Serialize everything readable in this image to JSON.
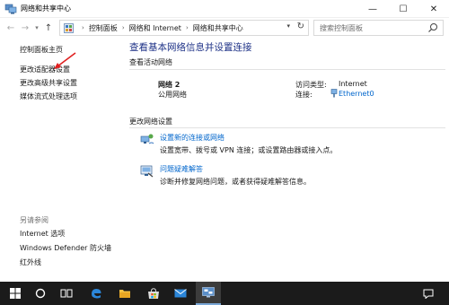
{
  "window": {
    "title": "网络和共享中心",
    "minimize": "—",
    "maximize": "☐",
    "close": "✕"
  },
  "address_bar": {
    "breadcrumbs": [
      "控制面板",
      "网络和 Internet",
      "网络和共享中心"
    ],
    "separator": "›",
    "search_placeholder": "搜索控制面板"
  },
  "sidebar": {
    "items": [
      {
        "label": "控制面板主页"
      },
      {
        "label": "更改适配器设置"
      },
      {
        "label": "更改高级共享设置"
      },
      {
        "label": "媒体流式处理选项"
      }
    ],
    "see_also_title": "另请参阅",
    "see_also": [
      {
        "label": "Internet 选项"
      },
      {
        "label": "Windows Defender 防火墙"
      },
      {
        "label": "红外线"
      }
    ]
  },
  "main": {
    "title": "查看基本网络信息并设置连接",
    "active_networks_label": "查看活动网络",
    "network": {
      "name": "网络 2",
      "type": "公用网络",
      "access_type_label": "访问类型:",
      "access_type_value": "Internet",
      "connections_label": "连接:",
      "connections_value": "Ethernet0"
    },
    "change_settings_label": "更改网络设置",
    "tasks": [
      {
        "link": "设置新的连接或网络",
        "desc": "设置宽带、拨号或 VPN 连接；或设置路由器或接入点。"
      },
      {
        "link": "问题疑难解答",
        "desc": "诊断并修复网络问题，或者获得疑难解答信息。"
      }
    ]
  },
  "taskbar": {
    "items": [
      "start-icon",
      "cortana-icon",
      "task-view-icon",
      "edge-icon",
      "file-explorer-icon",
      "store-icon",
      "mail-icon",
      "control-panel-icon"
    ],
    "show_desktop": "notification-icon"
  },
  "colors": {
    "title_blue": "#1e3287",
    "link_blue": "#0066cc",
    "taskbar": "#1b1b1b",
    "annotation_red": "#e02020"
  }
}
